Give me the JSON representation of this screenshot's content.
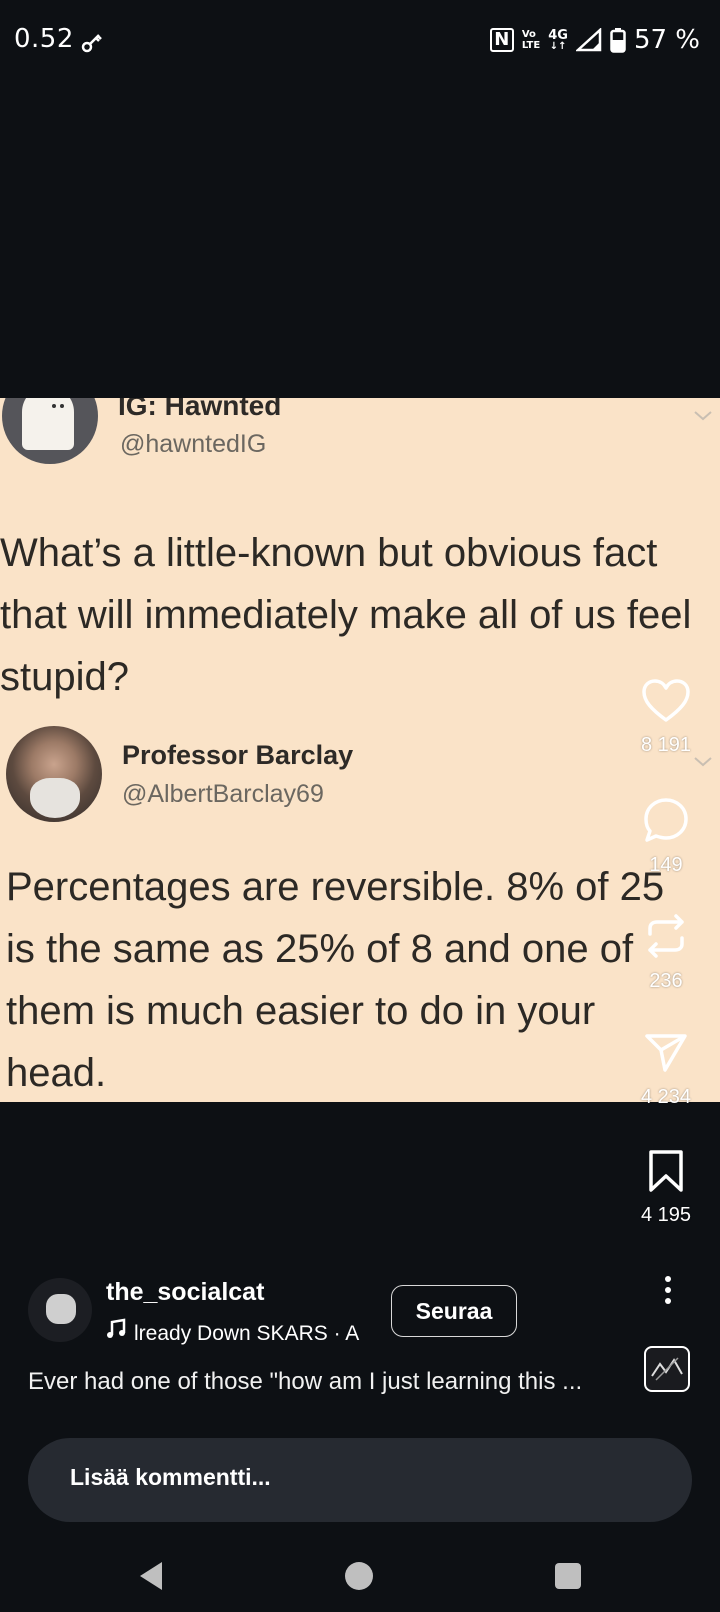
{
  "status_bar": {
    "time": "0.52",
    "network_top": "4G",
    "volte_line1": "Vo",
    "volte_line2": "LTE",
    "battery": "57 %"
  },
  "post": {
    "image": {
      "tweet1": {
        "name": "IG: Hawnted",
        "handle": "@hawntedIG",
        "text": "What’s a little-known but obvious fact\nthat will immediately make all of us feel\nstupid?"
      },
      "tweet2": {
        "name": "Professor Barclay",
        "handle": "@AlbertBarclay69",
        "text": "Percentages are reversible.  8% of 25\nis the same as 25% of 8 and one of\nthem is much easier to do in your\nhead."
      }
    },
    "actions": {
      "likes": "8 191",
      "comments": "149",
      "reposts": "236",
      "shares": "4 234",
      "saves": "4 195"
    },
    "author": {
      "username": "the_socialcat",
      "music": "lready Down    SKARS · A",
      "follow_label": "Seuraa"
    },
    "caption": "Ever had one of those \"how am I just learning this ..."
  },
  "comment_bar": {
    "placeholder": "Lisää kommentti..."
  },
  "icons": {
    "status_left": "vpn-key-icon",
    "nfc": "nfc-icon",
    "signal": "signal-icon",
    "battery": "battery-icon",
    "like": "heart-icon",
    "comment": "comment-icon",
    "repost": "repost-icon",
    "share": "send-icon",
    "save": "bookmark-icon",
    "more": "more-vertical-icon",
    "music": "music-note-icon"
  },
  "colors": {
    "background": "#0d1014",
    "image_background": "#fae3c8",
    "comment_bar": "#262a31"
  }
}
